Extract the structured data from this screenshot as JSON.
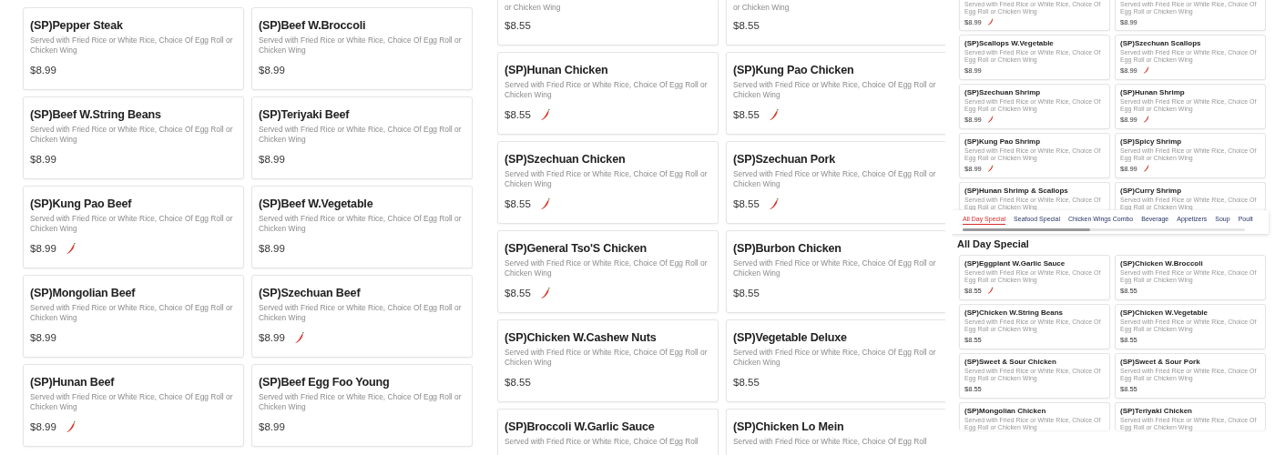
{
  "panels": [
    {
      "cards": [
        {
          "kind": "full",
          "title": "(SP)Pepper Steak",
          "description": "Served with Fried Rice or White Rice, Choice Of Egg Roll or Chicken Wing",
          "price": "$8.99",
          "spicy": false
        },
        {
          "kind": "full",
          "title": "(SP)Beef W.Broccoli",
          "description": "Served with Fried Rice or White Rice, Choice Of Egg Roll or Chicken Wing",
          "price": "$8.99",
          "spicy": false
        },
        {
          "kind": "full",
          "title": "(SP)Beef W.String Beans",
          "description": "Served with Fried Rice or White Rice, Choice Of Egg Roll or Chicken Wing",
          "price": "$8.99",
          "spicy": false
        },
        {
          "kind": "full",
          "title": "(SP)Teriyaki Beef",
          "description": "Served with Fried Rice or White Rice, Choice Of Egg Roll or Chicken Wing",
          "price": "$8.99",
          "spicy": false
        },
        {
          "kind": "full",
          "title": "(SP)Kung Pao Beef",
          "description": "Served with Fried Rice or White Rice, Choice Of Egg Roll or Chicken Wing",
          "price": "$8.99",
          "spicy": true
        },
        {
          "kind": "full",
          "title": "(SP)Beef W.Vegetable",
          "description": "Served with Fried Rice or White Rice, Choice Of Egg Roll or Chicken Wing",
          "price": "$8.99",
          "spicy": false
        },
        {
          "kind": "full",
          "title": "(SP)Mongolian Beef",
          "description": "Served with Fried Rice or White Rice, Choice Of Egg Roll or Chicken Wing",
          "price": "$8.99",
          "spicy": false
        },
        {
          "kind": "full",
          "title": "(SP)Szechuan Beef",
          "description": "Served with Fried Rice or White Rice, Choice Of Egg Roll or Chicken Wing",
          "price": "$8.99",
          "spicy": true
        },
        {
          "kind": "full",
          "title": "(SP)Hunan Beef",
          "description": "Served with Fried Rice or White Rice, Choice Of Egg Roll or Chicken Wing",
          "price": "$8.99",
          "spicy": true
        },
        {
          "kind": "full",
          "title": "(SP)Beef Egg Foo Young",
          "description": "Served with Fried Rice or White Rice, Choice Of Egg Roll or Chicken Wing",
          "price": "$8.99",
          "spicy": false
        }
      ]
    },
    {
      "cards": [
        {
          "kind": "cut-top",
          "description": "or Chicken Wing",
          "price": "$8.55",
          "spicy": false
        },
        {
          "kind": "cut-top",
          "description": "or Chicken Wing",
          "price": "$8.55",
          "spicy": false
        },
        {
          "kind": "full",
          "title": "(SP)Hunan Chicken",
          "description": "Served with Fried Rice or White Rice, Choice Of Egg Roll or Chicken Wing",
          "price": "$8.55",
          "spicy": true
        },
        {
          "kind": "full",
          "title": "(SP)Kung Pao Chicken",
          "description": "Served with Fried Rice or White Rice, Choice Of Egg Roll or Chicken Wing",
          "price": "$8.55",
          "spicy": true
        },
        {
          "kind": "full",
          "title": "(SP)Szechuan Chicken",
          "description": "Served with Fried Rice or White Rice, Choice Of Egg Roll or Chicken Wing",
          "price": "$8.55",
          "spicy": true
        },
        {
          "kind": "full",
          "title": "(SP)Szechuan Pork",
          "description": "Served with Fried Rice or White Rice, Choice Of Egg Roll or Chicken Wing",
          "price": "$8.55",
          "spicy": true
        },
        {
          "kind": "full",
          "title": "(SP)General Tso'S Chicken",
          "description": "Served with Fried Rice or White Rice, Choice Of Egg Roll or Chicken Wing",
          "price": "$8.55",
          "spicy": true
        },
        {
          "kind": "full",
          "title": "(SP)Burbon Chicken",
          "description": "Served with Fried Rice or White Rice, Choice Of Egg Roll or Chicken Wing",
          "price": "$8.55",
          "spicy": false
        },
        {
          "kind": "full",
          "title": "(SP)Chicken W.Cashew Nuts",
          "description": "Served with Fried Rice or White Rice, Choice Of Egg Roll or Chicken Wing",
          "price": "$8.55",
          "spicy": false
        },
        {
          "kind": "full",
          "title": "(SP)Vegetable Deluxe",
          "description": "Served with Fried Rice or White Rice, Choice Of Egg Roll or Chicken Wing",
          "price": "$8.55",
          "spicy": false
        },
        {
          "kind": "cut-bottom",
          "title": "(SP)Broccoli W.Garlic Sauce",
          "description": "Served with Fried Rice or White Rice, Choice Of Egg Roll"
        },
        {
          "kind": "cut-bottom",
          "title": "(SP)Chicken Lo Mein",
          "description": "Served with Fried Rice or White Rice, Choice Of Egg Roll"
        }
      ]
    },
    {
      "cards": [
        {
          "kind": "cut-top",
          "description": "Served with Fried Rice or White Rice, Choice Of Egg Roll or Chicken Wing",
          "price": "$8.99",
          "spicy": true
        },
        {
          "kind": "cut-top",
          "description": "Served with Fried Rice or White Rice, Choice Of Egg Roll or Chicken Wing",
          "price": "$8.99",
          "spicy": false
        },
        {
          "kind": "full",
          "title": "(SP)Scallops W.Vegetable",
          "description": "Served with Fried Rice or White Rice, Choice Of Egg Roll or Chicken Wing",
          "price": "$8.99",
          "spicy": false
        },
        {
          "kind": "full",
          "title": "(SP)Szechuan Scallops",
          "description": "Served with Fried Rice or White Rice, Choice Of Egg Roll or Chicken Wing",
          "price": "$8.99",
          "spicy": true
        },
        {
          "kind": "full",
          "title": "(SP)Szechuan Shrimp",
          "description": "Served with Fried Rice or White Rice, Choice Of Egg Roll or Chicken Wing",
          "price": "$8.99",
          "spicy": true
        },
        {
          "kind": "full",
          "title": "(SP)Hunan Shrimp",
          "description": "Served with Fried Rice or White Rice, Choice Of Egg Roll or Chicken Wing",
          "price": "$8.99",
          "spicy": true
        },
        {
          "kind": "full",
          "title": "(SP)Kung Pao Shrimp",
          "description": "Served with Fried Rice or White Rice, Choice Of Egg Roll or Chicken Wing",
          "price": "$8.99",
          "spicy": true
        },
        {
          "kind": "full",
          "title": "(SP)Spicy Shrimp",
          "description": "Served with Fried Rice or White Rice, Choice Of Egg Roll or Chicken Wing",
          "price": "$8.99",
          "spicy": true
        },
        {
          "kind": "cut-bottom",
          "title": "(SP)Hunan Shrimp & Scallops",
          "description": "Served with Fried Rice or White Rice, Choice Of Egg Roll or Chicken Wing"
        },
        {
          "kind": "cut-bottom",
          "title": "(SP)Curry Shrimp",
          "description": "Served with Fried Rice or White Rice, Choice Of Egg Roll or Chicken Wing"
        }
      ],
      "category_tabs": [
        {
          "label": "All Day Special",
          "selected": true
        },
        {
          "label": "Seafood Special",
          "selected": false
        },
        {
          "label": "Chicken Wings Combo",
          "selected": false
        },
        {
          "label": "Beverage",
          "selected": false
        },
        {
          "label": "Appetizers",
          "selected": false
        },
        {
          "label": "Soup",
          "selected": false
        },
        {
          "label": "Poult",
          "selected": false
        }
      ],
      "section_heading": "All Day Special",
      "section_cards": [
        {
          "kind": "full",
          "title": "(SP)Eggplant W.Garlic Sauce",
          "description": "Served with Fried Rice or White Rice, Choice Of Egg Roll or Chicken Wing",
          "price": "$8.55",
          "spicy": true
        },
        {
          "kind": "full",
          "title": "(SP)Chicken W.Broccoli",
          "description": "Served with Fried Rice or White Rice, Choice Of Egg Roll or Chicken Wing",
          "price": "$8.55",
          "spicy": false
        },
        {
          "kind": "full",
          "title": "(SP)Chicken W.String Beans",
          "description": "Served with Fried Rice or White Rice, Choice Of Egg Roll or Chicken Wing",
          "price": "$8.55",
          "spicy": false
        },
        {
          "kind": "full",
          "title": "(SP)Chicken W.Vegetable",
          "description": "Served with Fried Rice or White Rice, Choice Of Egg Roll or Chicken Wing",
          "price": "$8.55",
          "spicy": false
        },
        {
          "kind": "full",
          "title": "(SP)Sweet & Sour Chicken",
          "description": "Served with Fried Rice or White Rice, Choice Of Egg Roll or Chicken Wing",
          "price": "$8.55",
          "spicy": false
        },
        {
          "kind": "full",
          "title": "(SP)Sweet & Sour Pork",
          "description": "Served with Fried Rice or White Rice, Choice Of Egg Roll or Chicken Wing",
          "price": "$8.55",
          "spicy": false
        },
        {
          "kind": "cut-bottom",
          "title": "(SP)Mongolian Chicken",
          "description": "Served with Fried Rice or White Rice, Choice Of Egg Roll or Chicken Wing"
        },
        {
          "kind": "cut-bottom",
          "title": "(SP)Teriyaki Chicken",
          "description": "Served with Fried Rice or White Rice, Choice Of Egg Roll or Chicken Wing"
        }
      ]
    }
  ]
}
